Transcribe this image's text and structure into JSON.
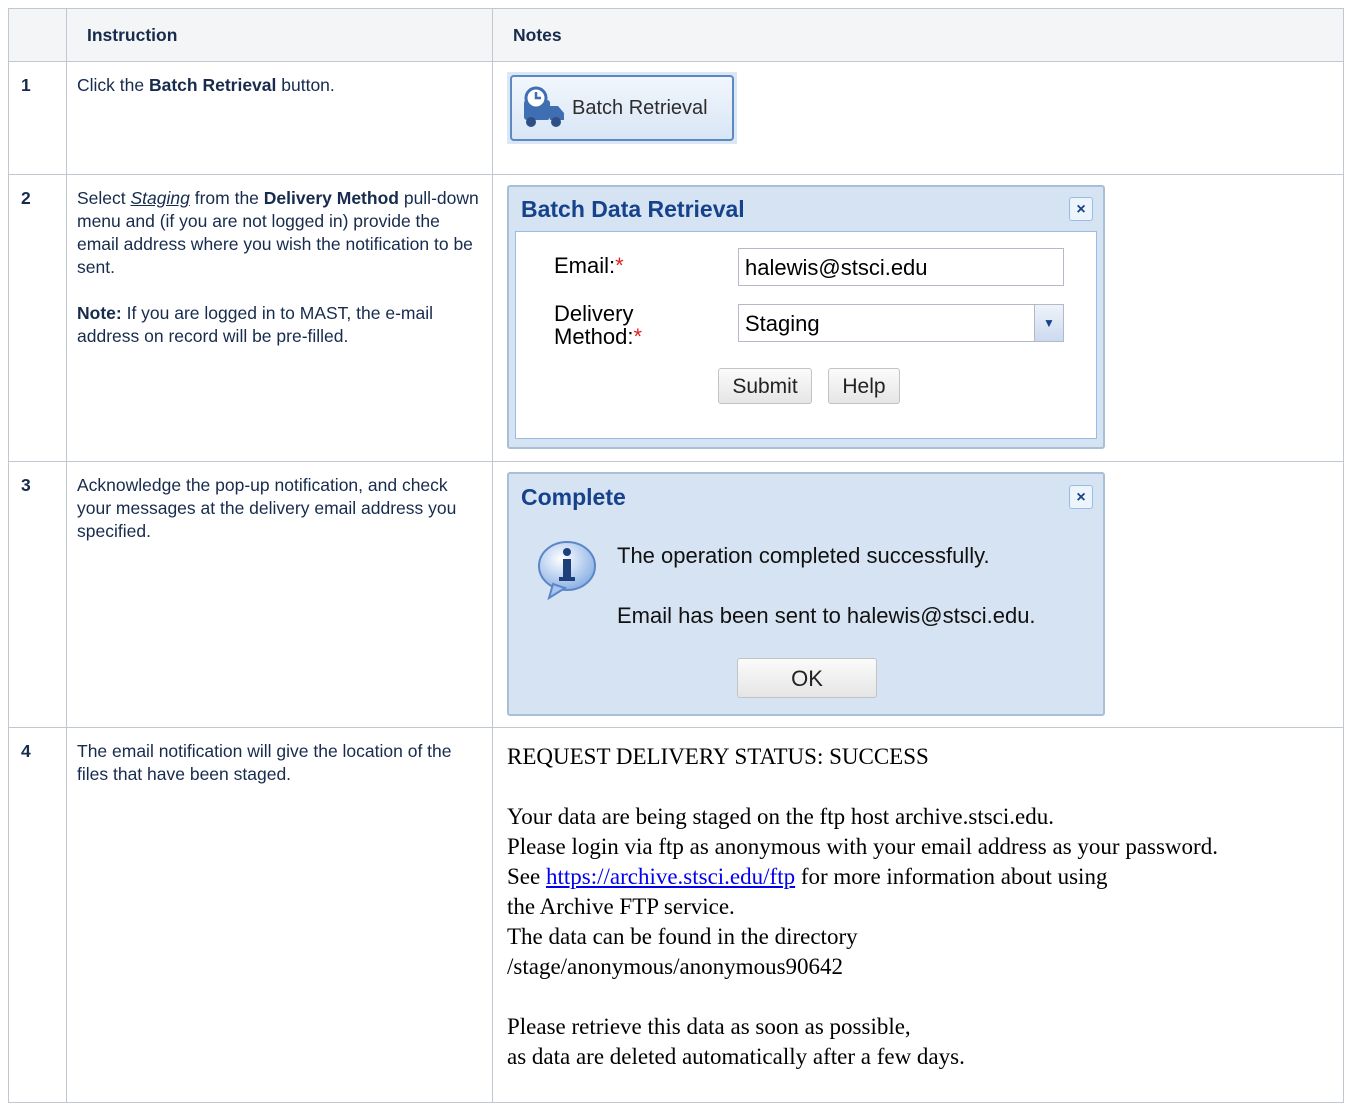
{
  "headers": {
    "col1": "",
    "col2": "Instruction",
    "col3": "Notes"
  },
  "rows": [
    {
      "num": "1",
      "instruction": {
        "pre": "Click the ",
        "bold": "Batch Retrieval",
        "post": " button."
      },
      "button_label": "Batch Retrieval"
    },
    {
      "num": "2",
      "instruction": {
        "p1_pre": "Select ",
        "p1_ital": "Staging",
        "p1_mid": " from the ",
        "p1_bold": "Delivery Method",
        "p1_post": " pull-down menu and (if you are not logged in) provide the email address where you wish the notification to be sent.",
        "p2_bold": "Note:",
        "p2_post": " If you are logged in to MAST, the e-mail address on record will be pre-filled."
      },
      "dialog": {
        "title": "Batch Data Retrieval",
        "close": "×",
        "email_label": "Email:",
        "required_mark": "*",
        "email_value": "halewis@stsci.edu",
        "delivery_label_1": "Delivery",
        "delivery_label_2": "Method:",
        "delivery_value": "Staging",
        "submit": "Submit",
        "help": "Help"
      }
    },
    {
      "num": "3",
      "instruction": {
        "text": "Acknowledge the pop-up notification, and check your messages at the delivery email address you specified."
      },
      "dialog": {
        "title": "Complete",
        "close": "×",
        "message1": "The operation completed successfully.",
        "message2": "Email has been sent to halewis@stsci.edu.",
        "ok": "OK"
      }
    },
    {
      "num": "4",
      "instruction": {
        "text": "The email notification will give the location of the files that have been staged."
      },
      "email": {
        "status": "REQUEST DELIVERY STATUS: SUCCESS",
        "l1": "Your data are being staged on the ftp host archive.stsci.edu.",
        "l2": "Please login via ftp as anonymous with your email address as your password.",
        "l3_pre": "See ",
        "l3_link": "https://archive.stsci.edu/ftp",
        "l3_post": " for more information about using",
        "l4": "the Archive FTP service.",
        "l5": "The data can be found in the directory",
        "l6": "/stage/anonymous/anonymous90642",
        "l7": "Please retrieve this data as soon as possible,",
        "l8": "as data are deleted automatically after a few days."
      }
    }
  ],
  "colors": {
    "border": "#c1c7d0",
    "header_bg": "#f4f5f7",
    "ext_title": "#15428b",
    "link": "#0000ee"
  }
}
